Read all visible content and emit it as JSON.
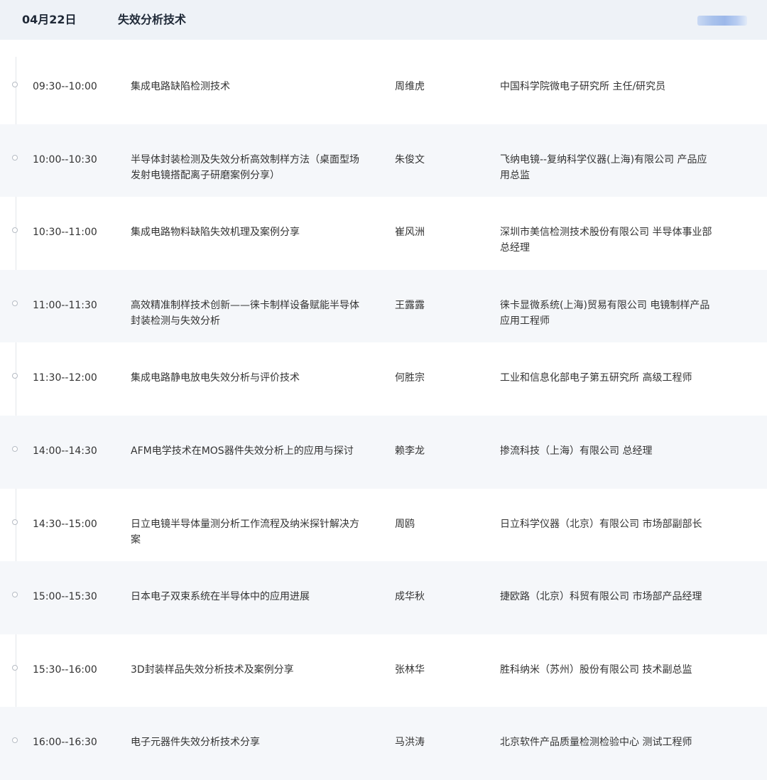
{
  "header": {
    "date": "04月22日",
    "title": "失效分析技术"
  },
  "sessions": [
    {
      "time": "09:30--10:00",
      "topic": "集成电路缺陷检测技术",
      "speaker": "周维虎",
      "org": "中国科学院微电子研究所 主任/研究员"
    },
    {
      "time": "10:00--10:30",
      "topic": "半导体封装检测及失效分析高效制样方法（桌面型场发射电镜搭配离子研磨案例分享）",
      "speaker": "朱俊文",
      "org": "飞纳电镜--复纳科学仪器(上海)有限公司 产品应用总监"
    },
    {
      "time": "10:30--11:00",
      "topic": "集成电路物料缺陷失效机理及案例分享",
      "speaker": "崔风洲",
      "org": "深圳市美信检测技术股份有限公司 半导体事业部总经理"
    },
    {
      "time": "11:00--11:30",
      "topic": "高效精准制样技术创新——徕卡制样设备赋能半导体封装检测与失效分析",
      "speaker": "王露露",
      "org": "徕卡显微系统(上海)贸易有限公司 电镜制样产品应用工程师"
    },
    {
      "time": "11:30--12:00",
      "topic": "集成电路静电放电失效分析与评价技术",
      "speaker": "何胜宗",
      "org": "工业和信息化部电子第五研究所 高级工程师"
    },
    {
      "time": "14:00--14:30",
      "topic": "AFM电学技术在MOS器件失效分析上的应用与探讨",
      "speaker": "赖李龙",
      "org": "掺流科技（上海）有限公司 总经理"
    },
    {
      "time": "14:30--15:00",
      "topic": "日立电镜半导体量测分析工作流程及纳米探针解决方案",
      "speaker": "周鸥",
      "org": "日立科学仪器（北京）有限公司 市场部副部长"
    },
    {
      "time": "15:00--15:30",
      "topic": "日本电子双束系统在半导体中的应用进展",
      "speaker": "成华秋",
      "org": "捷欧路（北京）科贸有限公司 市场部产品经理"
    },
    {
      "time": "15:30--16:00",
      "topic": "3D封装样品失效分析技术及案例分享",
      "speaker": "张林华",
      "org": "胜科纳米（苏州）股份有限公司 技术副总监"
    },
    {
      "time": "16:00--16:30",
      "topic": "电子元器件失效分析技术分享",
      "speaker": "马洪涛",
      "org": "北京软件产品质量检测检验中心 测试工程师"
    }
  ]
}
